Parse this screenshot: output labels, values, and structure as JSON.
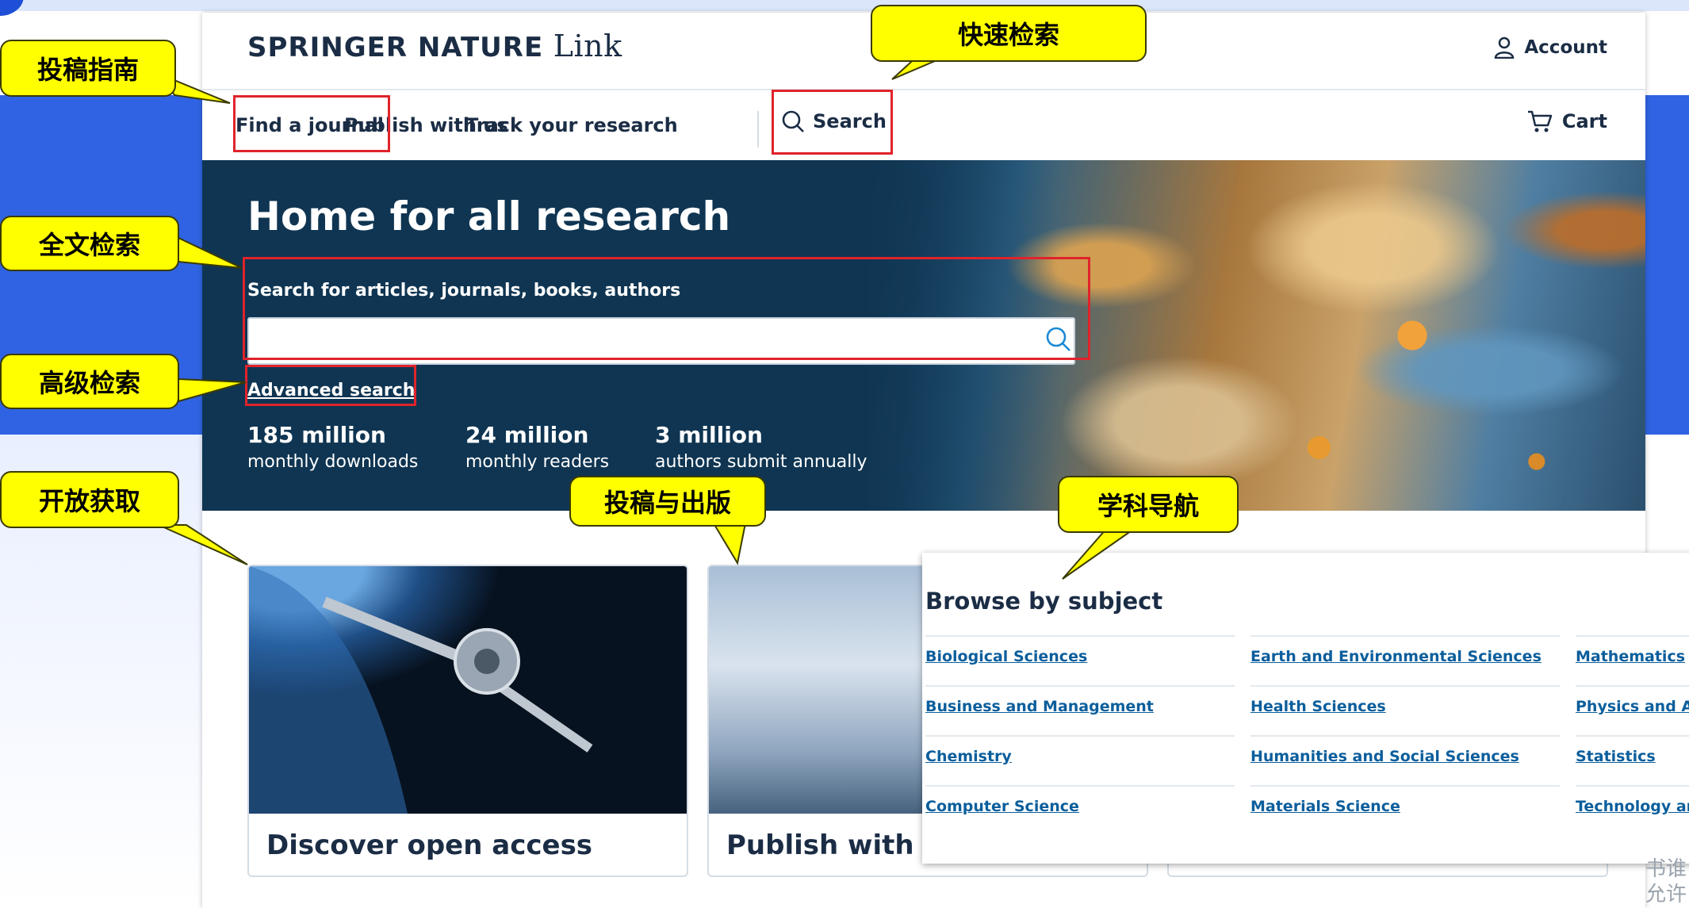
{
  "header": {
    "logo_brand": "SPRINGER NATURE",
    "logo_product": "Link",
    "account_label": "Account"
  },
  "nav": {
    "items": [
      "Find a journal",
      "Publish with us",
      "Track your research"
    ],
    "search_label": "Search",
    "cart_label": "Cart"
  },
  "hero": {
    "title": "Home for all research",
    "search_label": "Search for articles, journals, books, authors",
    "search_value": "",
    "advanced_search": "Advanced search",
    "stats": [
      {
        "number": "185 million",
        "label": "monthly downloads"
      },
      {
        "number": "24 million",
        "label": "monthly readers"
      },
      {
        "number": "3 million",
        "label": "authors submit annually"
      }
    ]
  },
  "cards": [
    {
      "title": "Discover open access"
    },
    {
      "title": "Publish with us"
    }
  ],
  "browse": {
    "title": "Browse by subject",
    "columns": [
      [
        "Biological Sciences",
        "Business and Management",
        "Chemistry",
        "Computer Science"
      ],
      [
        "Earth and Environmental Sciences",
        "Health Sciences",
        "Humanities and Social Sciences",
        "Materials Science"
      ],
      [
        "Mathematics",
        "Physics and Astr",
        "Statistics",
        "Technology and E"
      ]
    ]
  },
  "callouts": {
    "submission_guide": "投稿指南",
    "quick_search": "快速检索",
    "fulltext_search": "全文检索",
    "advanced_search": "高级检索",
    "open_access": "开放获取",
    "submission_publishing": "投稿与出版",
    "subject_navigation": "学科导航"
  },
  "watermark": [
    "书谁",
    "允许"
  ],
  "colors": {
    "slide_blue": "#2f63e3",
    "callout_yellow": "#ffff00",
    "highlight_red": "#e0232b",
    "hero_navy": "#0f3552",
    "link_blue": "#0b5e9c"
  }
}
